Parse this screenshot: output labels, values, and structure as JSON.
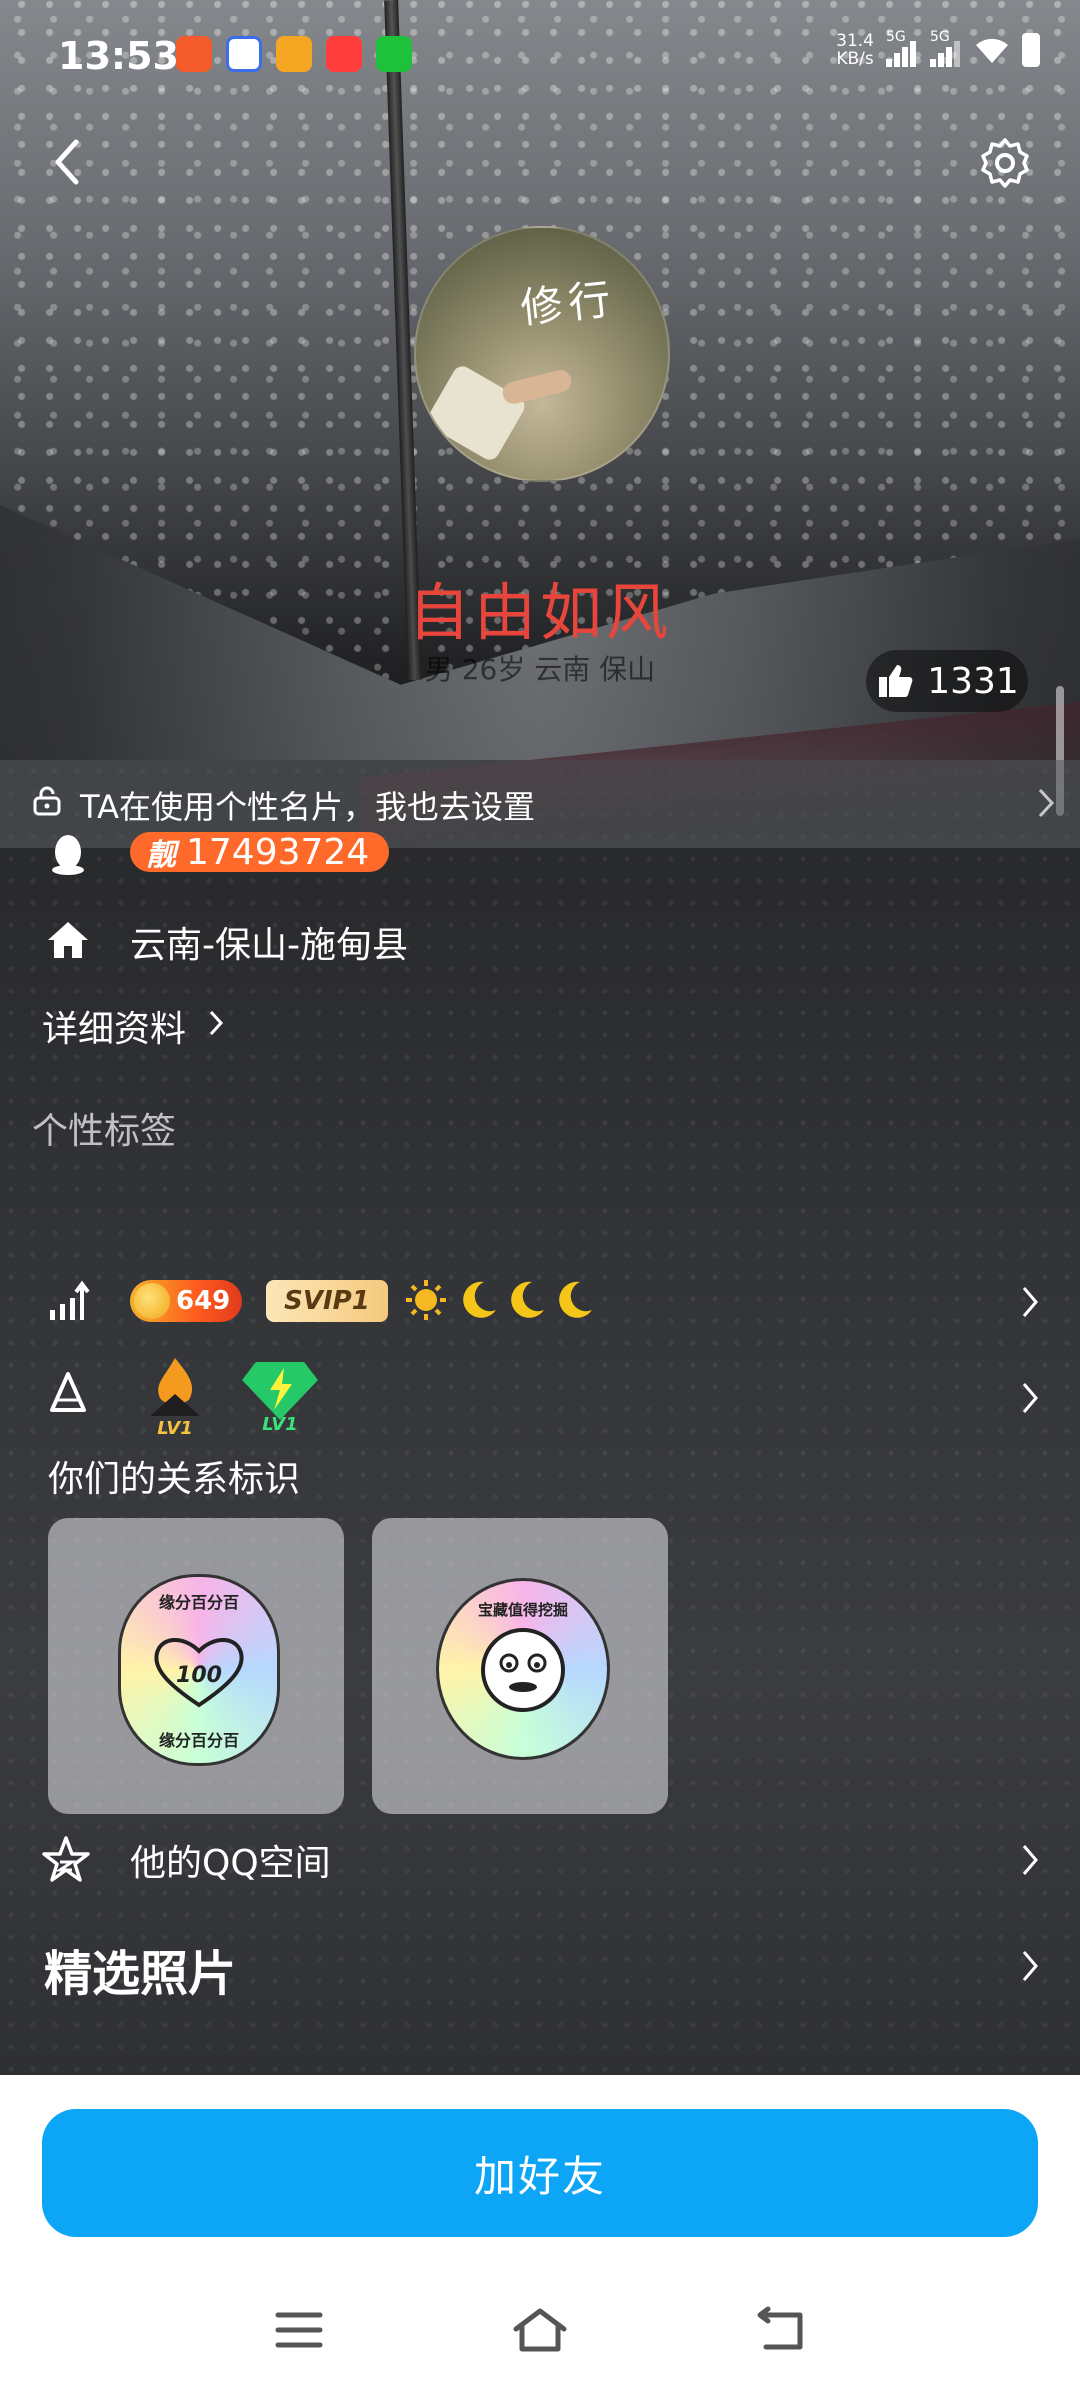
{
  "status_bar": {
    "time": "13:53",
    "net_speed": "31.4\nKB/s",
    "signal1": "5G",
    "signal2": "5G"
  },
  "profile": {
    "avatar_text": "修行",
    "nickname": "自由如风",
    "subtitle": "男 26岁  云南 保山",
    "likes": "1331"
  },
  "card_bar": {
    "text": "TA在使用个性名片，我也去设置"
  },
  "info": {
    "liang": "靓",
    "qq_number": "17493724",
    "address": "云南-保山-施甸县",
    "detail_link": "详细资料",
    "tags_label": "个性标签"
  },
  "levels": {
    "coin_value": "649",
    "svip": "SVIP1"
  },
  "badges": {
    "fire_level": "LV1",
    "gem_level": "LV1"
  },
  "relationship": {
    "label": "你们的关系标识",
    "card1_text_top": "缘分百分百",
    "card1_text_bottom": "缘分百分百",
    "card1_center": "100",
    "card2_text": "宝藏值得挖掘"
  },
  "qzone": {
    "label": "他的QQ空间"
  },
  "photos": {
    "label": "精选照片"
  },
  "actions": {
    "add_friend": "加好友"
  },
  "colors": {
    "accent_blue": "#0da6f7",
    "nickname_red": "#e8453c",
    "qq_badge_orange": "#ff6a2b"
  }
}
